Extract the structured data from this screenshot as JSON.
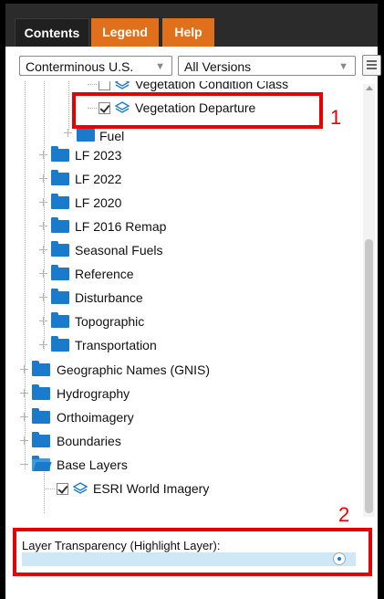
{
  "tabs": [
    {
      "label": "Contents",
      "active": true
    },
    {
      "label": "Legend",
      "active": false
    },
    {
      "label": "Help",
      "active": false
    }
  ],
  "toolbar": {
    "region_select": "Conterminous U.S.",
    "version_select": "All Versions",
    "menu_icon": "hamburger-menu-icon"
  },
  "tree": {
    "vegetation_condition_class": {
      "label": "Vegetation Condition Class",
      "checked": false
    },
    "vegetation_departure": {
      "label": "Vegetation Departure",
      "checked": true
    },
    "fuel": "Fuel",
    "folders": [
      {
        "label": "LF 2023"
      },
      {
        "label": "LF 2022"
      },
      {
        "label": "LF 2020"
      },
      {
        "label": "LF 2016 Remap"
      },
      {
        "label": "Seasonal Fuels"
      },
      {
        "label": "Reference"
      },
      {
        "label": "Disturbance"
      },
      {
        "label": "Topographic"
      },
      {
        "label": "Transportation"
      }
    ],
    "top_folders": [
      {
        "label": "Geographic Names (GNIS)"
      },
      {
        "label": "Hydrography"
      },
      {
        "label": "Orthoimagery"
      },
      {
        "label": "Boundaries"
      }
    ],
    "base_layers": "Base Layers",
    "esri_world_imagery": {
      "label": "ESRI World Imagery",
      "checked": true
    }
  },
  "callouts": {
    "one": "1",
    "two": "2"
  },
  "transparency": {
    "label": "Layer Transparency (Highlight Layer):",
    "value_fraction": 0.97
  },
  "colors": {
    "accent_tab": "#e0701b",
    "folder": "#1a7bcd",
    "highlight": "#e60000",
    "slider_track": "#cfe8f8"
  }
}
